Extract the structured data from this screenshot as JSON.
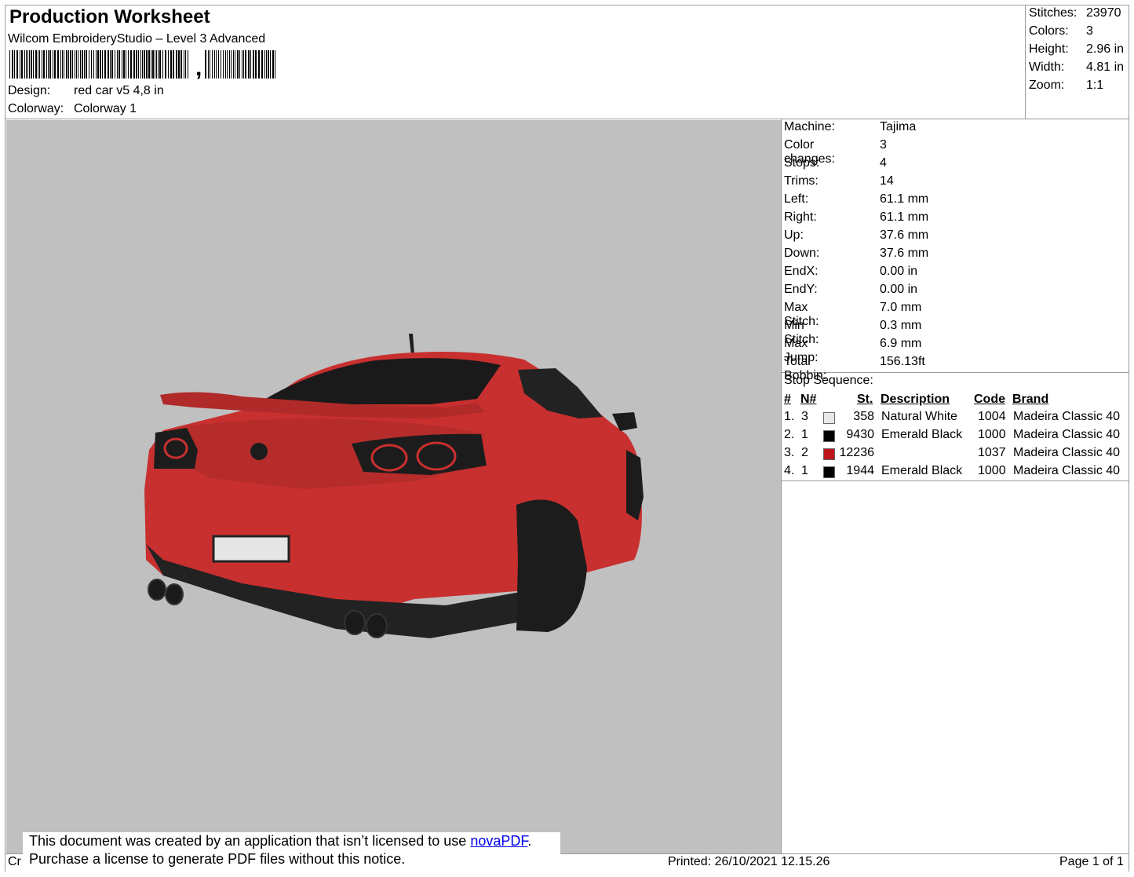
{
  "header": {
    "title": "Production Worksheet",
    "software": "Wilcom EmbroideryStudio – Level 3 Advanced",
    "barcode_suffix": ",",
    "design_label": "Design:",
    "design_value": "red car v5 4,8 in",
    "colorway_label": "Colorway:",
    "colorway_value": "Colorway 1"
  },
  "summary": [
    {
      "label": "Stitches:",
      "value": "23970"
    },
    {
      "label": "Colors:",
      "value": "3"
    },
    {
      "label": "Height:",
      "value": "2.96 in"
    },
    {
      "label": "Width:",
      "value": "4.81 in"
    },
    {
      "label": "Zoom:",
      "value": "1:1"
    }
  ],
  "machine_info": [
    {
      "label": "Machine:",
      "value": "Tajima"
    },
    {
      "label": "Color changes:",
      "value": "3"
    },
    {
      "label": "Stops:",
      "value": "4"
    },
    {
      "label": "Trims:",
      "value": "14"
    },
    {
      "label": "Left:",
      "value": "61.1 mm"
    },
    {
      "label": "Right:",
      "value": "61.1 mm"
    },
    {
      "label": "Up:",
      "value": "37.6 mm"
    },
    {
      "label": "Down:",
      "value": "37.6 mm"
    },
    {
      "label": "EndX:",
      "value": "0.00 in"
    },
    {
      "label": "EndY:",
      "value": "0.00 in"
    },
    {
      "label": "Max Stitch:",
      "value": "7.0 mm"
    },
    {
      "label": "Min Stitch:",
      "value": "0.3 mm"
    },
    {
      "label": "Max Jump:",
      "value": "6.9 mm"
    },
    {
      "label": "Total Bobbin:",
      "value": "156.13ft"
    }
  ],
  "stop_sequence": {
    "title": "Stop Sequence:",
    "headers": {
      "num": "#",
      "n": "N#",
      "st": "St.",
      "description": "Description",
      "code": "Code",
      "brand": "Brand"
    },
    "rows": [
      {
        "num": "1.",
        "n": "3",
        "color": "#e8e8e8",
        "st": "358",
        "description": "Natural White",
        "code": "1004",
        "brand": "Madeira Classic 40"
      },
      {
        "num": "2.",
        "n": "1",
        "color": "#000000",
        "st": "9430",
        "description": "Emerald Black",
        "code": "1000",
        "brand": "Madeira Classic 40"
      },
      {
        "num": "3.",
        "n": "2",
        "color": "#c0141c",
        "st": "12236",
        "description": "",
        "code": "1037",
        "brand": "Madeira Classic 40"
      },
      {
        "num": "4.",
        "n": "1",
        "color": "#000000",
        "st": "1944",
        "description": "Emerald Black",
        "code": "1000",
        "brand": "Madeira Classic 40"
      }
    ]
  },
  "footer": {
    "left_fragment": "Cr",
    "notice_line1": "This document was created by an application that isn’t licensed to use ",
    "notice_link": "novaPDF",
    "notice_period": ".",
    "notice_line2": "Purchase a license to generate PDF files without this notice.",
    "printed": "Printed: 26/10/2021 12.15.26",
    "page": "Page 1 of 1"
  }
}
